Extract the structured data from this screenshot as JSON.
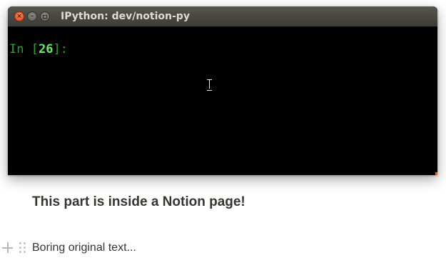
{
  "window": {
    "title": "IPython: dev/notion-py",
    "close_glyph": "×",
    "minimize_glyph": "–"
  },
  "terminal": {
    "prompt_prefix": "In [",
    "prompt_number": "26",
    "prompt_suffix": "]:"
  },
  "notion": {
    "heading": "This part is inside a Notion page!",
    "paragraph": "Boring original text..."
  },
  "colors": {
    "terminal_bg": "#000000",
    "prompt_green": "#1ea81e",
    "prompt_number_green": "#5ef25e",
    "close_button": "#df4a16",
    "notion_text": "#37352f"
  }
}
